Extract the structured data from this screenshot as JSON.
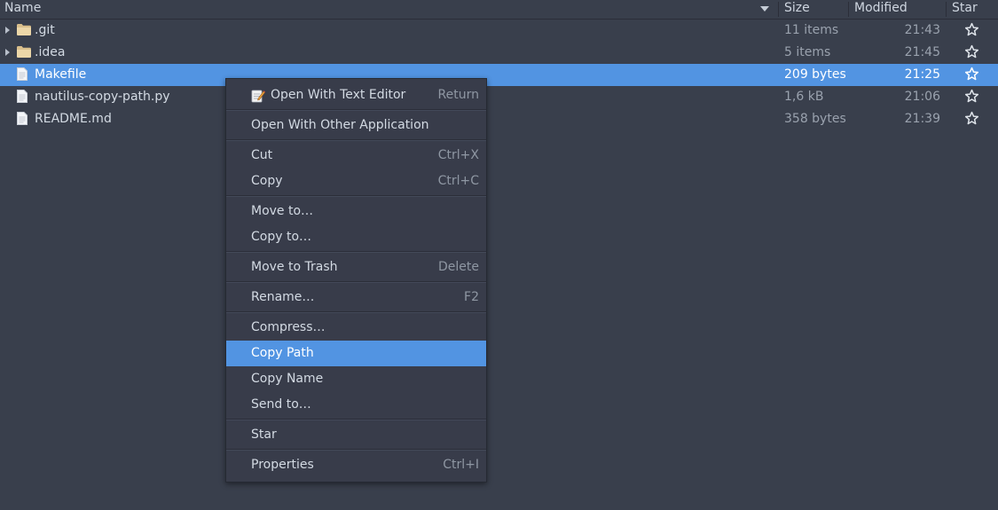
{
  "columns": {
    "name": "Name",
    "size": "Size",
    "modified": "Modified",
    "star": "Star"
  },
  "files": [
    {
      "name": ".git",
      "size": "11 items",
      "modified": "21:43",
      "type": "folder-icon",
      "expandable": true,
      "selected": false
    },
    {
      "name": ".idea",
      "size": "5 items",
      "modified": "21:45",
      "type": "folder-icon",
      "expandable": true,
      "selected": false
    },
    {
      "name": "Makefile",
      "size": "209 bytes",
      "modified": "21:25",
      "type": "file-icon",
      "expandable": false,
      "selected": true
    },
    {
      "name": "nautilus-copy-path.py",
      "size": "1,6 kB",
      "modified": "21:06",
      "type": "file-icon",
      "expandable": false,
      "selected": false
    },
    {
      "name": "README.md",
      "size": "358 bytes",
      "modified": "21:39",
      "type": "file-icon",
      "expandable": false,
      "selected": false
    }
  ],
  "context_menu": {
    "items": [
      {
        "label": "Open With Text Editor",
        "accel": "Return",
        "icon": "text-editor-icon"
      },
      {
        "label": "Open With Other Application",
        "accel": ""
      },
      {
        "label": "Cut",
        "accel": "Ctrl+X"
      },
      {
        "label": "Copy",
        "accel": "Ctrl+C"
      },
      {
        "label": "Move to…",
        "accel": ""
      },
      {
        "label": "Copy to…",
        "accel": ""
      },
      {
        "label": "Move to Trash",
        "accel": "Delete"
      },
      {
        "label": "Rename…",
        "accel": "F2"
      },
      {
        "label": "Compress…",
        "accel": ""
      },
      {
        "label": "Copy Path",
        "accel": "",
        "highlighted": true
      },
      {
        "label": "Copy Name",
        "accel": ""
      },
      {
        "label": "Send to…",
        "accel": ""
      },
      {
        "label": "Star",
        "accel": ""
      },
      {
        "label": "Properties",
        "accel": "Ctrl+I"
      }
    ]
  },
  "colors": {
    "background": "#393f4c",
    "selection": "#5294e2",
    "menu_background": "#383c4a",
    "text": "#d3dae3",
    "dim_text": "#9aa2ae",
    "folder": "#e6cd9c"
  }
}
